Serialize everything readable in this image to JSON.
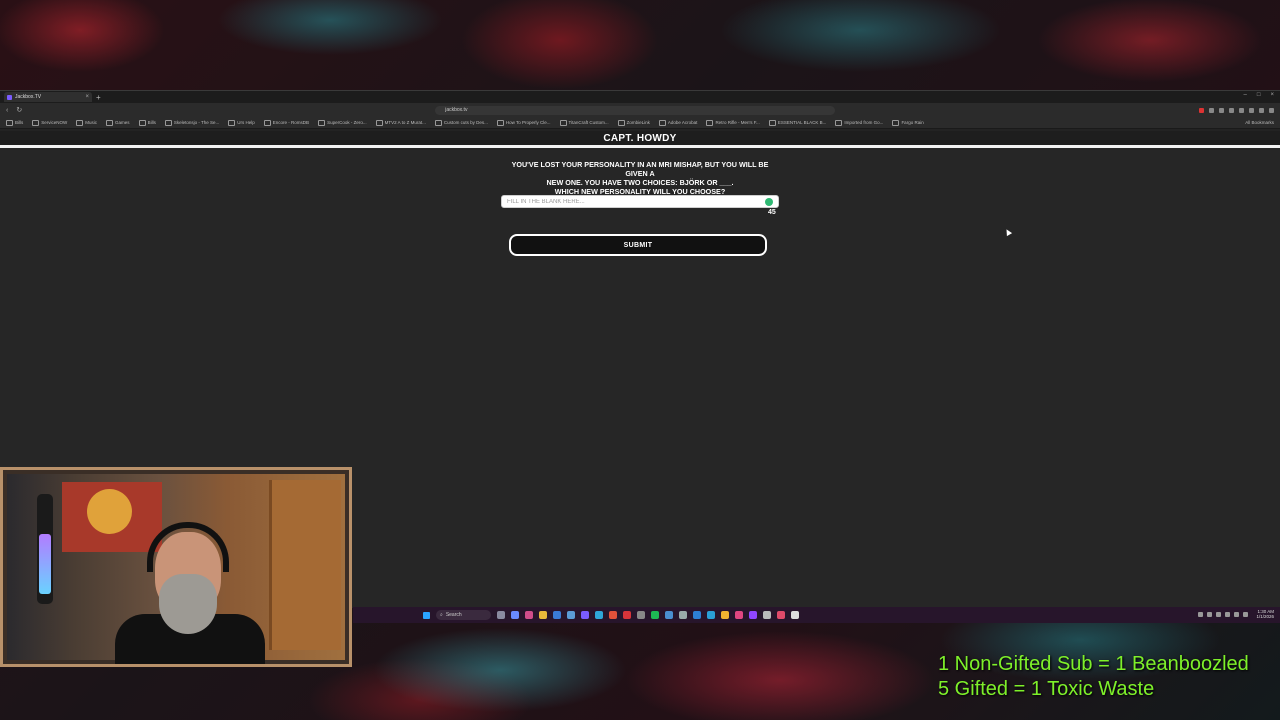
{
  "browser": {
    "tab_title": "Jackbox.TV",
    "new_tab": "+",
    "url": "jackbox.tv",
    "bookmarks": [
      "Bills",
      "ServiceNOW",
      "Music",
      "Games",
      "Bills",
      "Skeletonsjo - The Se...",
      "Urs Help",
      "Encore - RomsDB",
      "SuperCook - Zero...",
      "MTV2 A to Z Murat...",
      "Custom cuts by Des...",
      "How To Properly Cle...",
      "TitanCraft Custom...",
      "ZombieLink",
      "Adobe Acrobat",
      "Retro Rifle - Men's F...",
      "ESSENTIAL BLACK B...",
      "Imported from Go...",
      "Fargo Rain"
    ],
    "all_bookmarks": "All Bookmarks"
  },
  "game": {
    "player_name": "CAPT. HOWDY",
    "prompt_line1": "YOU'VE LOST YOUR PERSONALITY IN AN MRI MISHAP, BUT YOU WILL BE GIVEN A",
    "prompt_line2": "NEW ONE. YOU HAVE TWO CHOICES: BJÖRK OR ___.",
    "prompt_line3": "WHICH NEW PERSONALITY WILL YOU CHOOSE?",
    "input_placeholder": "FILL IN THE BLANK HERE...",
    "input_value": "",
    "char_count": "45",
    "submit_label": "SUBMIT"
  },
  "taskbar": {
    "search_label": "Search",
    "time": "1:30 AM",
    "date": "1/1/2026"
  },
  "overlay": {
    "line1": "1 Non-Gifted Sub = 1 Beanboozled",
    "line2": "5 Gifted = 1 Toxic Waste"
  },
  "colors": {
    "overlay_text": "#7ef02a",
    "page_bg": "#262626",
    "webcam_frame": "#b8916a"
  }
}
